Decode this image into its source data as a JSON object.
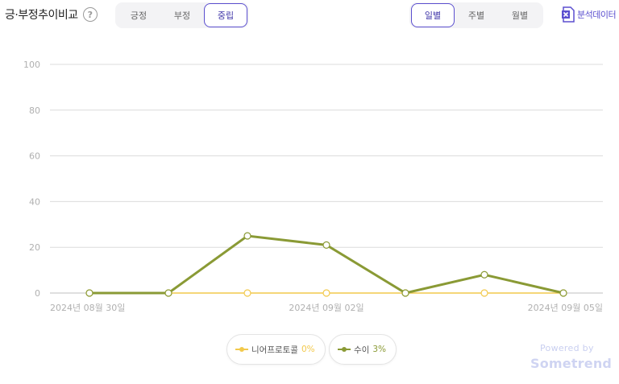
{
  "header": {
    "title": "긍·부정추이비교",
    "help_symbol": "?"
  },
  "sentiment_tabs": [
    {
      "label": "긍정",
      "active": false
    },
    {
      "label": "부정",
      "active": false
    },
    {
      "label": "중립",
      "active": true
    }
  ],
  "period_tabs": [
    {
      "label": "일별",
      "active": true
    },
    {
      "label": "주별",
      "active": false
    },
    {
      "label": "월별",
      "active": false
    }
  ],
  "export": {
    "label": "분석데이터",
    "icon": "excel-icon"
  },
  "colors": {
    "accent": "#5b4fcf",
    "series_1": "#f2c94c",
    "series_2": "#8a9a35"
  },
  "chart_data": {
    "type": "line",
    "x": [
      "2024-08-30",
      "2024-08-31",
      "2024-09-01",
      "2024-09-02",
      "2024-09-03",
      "2024-09-04",
      "2024-09-05"
    ],
    "xtick_labels": [
      "2024년 08월 30일",
      "2024년 09월 02일",
      "2024년 09월 05일"
    ],
    "ylim": [
      0,
      100
    ],
    "yticks": [
      0,
      20,
      40,
      60,
      80,
      100
    ],
    "grid": true,
    "legend_placement": "bottom-center",
    "series": [
      {
        "name": "니어프로토콜",
        "percent": "0%",
        "color": "#f2c94c",
        "values": [
          0,
          0,
          0,
          0,
          0,
          0,
          0
        ]
      },
      {
        "name": "수이",
        "percent": "3%",
        "color": "#8a9a35",
        "values": [
          0,
          0,
          25,
          21,
          0,
          8,
          0
        ]
      }
    ]
  },
  "footer": {
    "powered_by": "Powered by",
    "brand": "Sometrend"
  }
}
